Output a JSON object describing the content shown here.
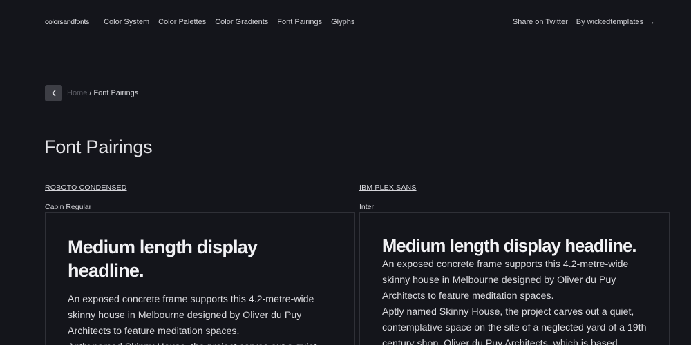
{
  "nav": {
    "brand": "colorsandfonts",
    "links": [
      "Color System",
      "Color Palettes",
      "Color Gradients",
      "Font Pairings",
      "Glyphs"
    ],
    "share": "Share on Twitter",
    "by": "By wickedtemplates",
    "arrow_icon": "arrow-right-icon"
  },
  "breadcrumb": {
    "back_icon": "chevron-left-icon",
    "home": "Home",
    "separator": "/",
    "current": "Font Pairings"
  },
  "page": {
    "title": "Font Pairings"
  },
  "pairings": [
    {
      "heading_font": "ROBOTO CONDENSED",
      "body_font": "Cabin Regular",
      "headline": "Medium length display headline.",
      "paragraph1": "An exposed concrete frame supports this 4.2-metre-wide skinny house in Melbourne designed by Oliver du Puy Architects to feature meditation spaces.",
      "paragraph2": "Aptly named Skinny House, the project carves out a quiet,"
    },
    {
      "heading_font": "IBM PLEX SANS",
      "body_font": "Inter",
      "headline": "Medium length display headline.",
      "paragraph1": "An exposed concrete frame supports this 4.2-metre-wide skinny house in Melbourne designed by Oliver du Puy Architects to feature meditation spaces.",
      "paragraph2": "Aptly named Skinny House, the project carves out a quiet, contemplative space on the site of a neglected yard of a 19th century shop, Oliver du Puy Architects, which is based"
    }
  ],
  "colors": {
    "background": "#14151b",
    "text": "#d9d9de",
    "muted": "#5d5e66",
    "border": "#2f3037",
    "button": "#3d3e45"
  }
}
